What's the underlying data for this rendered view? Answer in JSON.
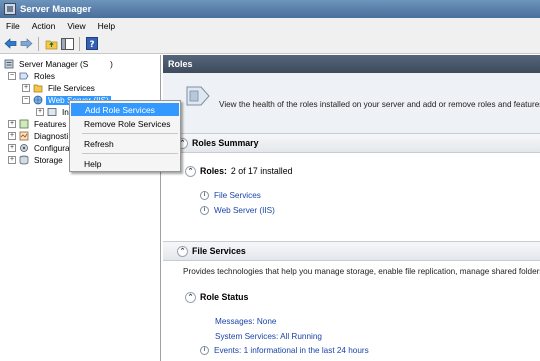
{
  "window": {
    "title": "Server Manager"
  },
  "menu": [
    "File",
    "Action",
    "View",
    "Help"
  ],
  "toolbar": {
    "icons": [
      "back-arrow-icon",
      "forward-arrow-icon",
      "up-folder-icon",
      "show-hide-pane-icon",
      "help-icon"
    ]
  },
  "tree": {
    "root": "Server Manager (S",
    "root_hidden_suffix": ")",
    "roles": "Roles",
    "file_services": "File Services",
    "web_server": "Web Server (IIS)",
    "iis_child": "In",
    "features": "Features",
    "diagnostics": "Diagnosti",
    "configuration": "Configura",
    "storage": "Storage"
  },
  "context_menu": {
    "items": [
      "Add Role Services",
      "Remove Role Services",
      "Refresh",
      "Help"
    ],
    "highlighted": "Add Role Services"
  },
  "right_pane": {
    "header": "Roles",
    "intro": "View the health of the roles installed on your server and add or remove roles and features.",
    "roles_summary": "Roles Summary",
    "roles_label": "Roles:",
    "roles_count": "2 of 17 installed",
    "role_links": [
      "File Services",
      "Web Server (IIS)"
    ],
    "file_services_header": "File Services",
    "file_services_desc": "Provides technologies that help you manage storage, enable file replication, manage shared folders",
    "role_status": "Role Status",
    "messages": "Messages: None",
    "system_services": "System Services: All Running",
    "events": "Events: 1 informational in the last 24 hours"
  }
}
